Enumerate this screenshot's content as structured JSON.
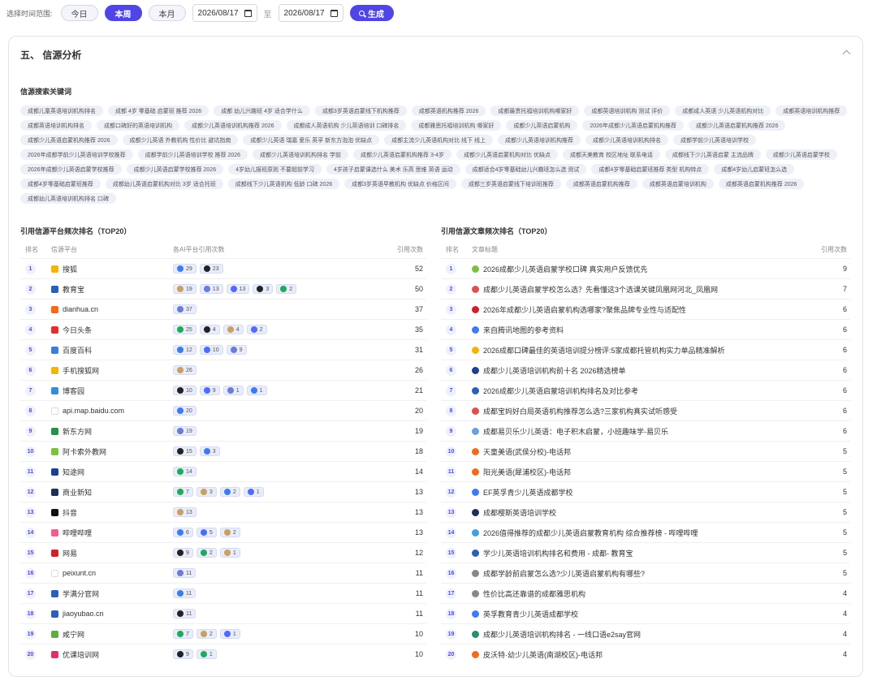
{
  "filters": {
    "label": "选择时间范围:",
    "options": [
      "今日",
      "本周",
      "本月"
    ],
    "active_index": 1,
    "date_start": "2026/08/17",
    "separator": "至",
    "date_end": "2026/08/17",
    "generate_label": "生成"
  },
  "section": {
    "title": "五、 信源分析"
  },
  "keywords": {
    "title": "信源搜索关键词",
    "items": [
      "成都儿童英语培训机构排名",
      "成都 4岁 零基础 启蒙班 推荐 2026",
      "成都 幼儿兴趣班 4岁 适合学什么",
      "成都3岁英语启蒙线下机构推荐",
      "成都英语机构推荐 2026",
      "成都最贵托福培训机构哪家好",
      "成都英语培训机构 测试 评价",
      "成都成人英语 少儿英语机构对比",
      "成都英语培训机构推荐",
      "成都英语培训机构排名",
      "成都口碑好的英语培训机构",
      "成都少儿英语培训机构推荐 2026",
      "成都成人英语机构 少儿英语培训 口碑排名",
      "成都雅思托福培训机构 哪家好",
      "成都少儿英语启蒙机构",
      "2026年成都少儿英语启蒙机构推荐",
      "成都少儿英语启蒙机构推荐 2026",
      "成都少儿英语启蒙机构推荐 2026",
      "成都少儿英语 外教机构 性价比 避坑指南",
      "成都少儿英语 瑞嘉 爱乐 英孚 新东方泡泡 优缺点",
      "成都主流少儿英语机构对比 线下 线上",
      "成都少儿英语培训机构推荐",
      "成都少儿英语培训机构排名",
      "成都学前少儿英语培训学校",
      "2026年成都学前少儿英语培训学校推荐",
      "成都学前少儿英语培训学校 推荐 2026",
      "成都少儿英语培训机构排名 学前",
      "成都少儿英语启蒙机构推荐 3-4岁",
      "成都少儿英语启蒙机构对比 优缺点",
      "成都天美教育 校区地址 联系电话",
      "成都线下少儿英语启蒙 主流品牌",
      "成都少儿英语启蒙学校",
      "2026年成都少儿英语启蒙学校推荐",
      "成都少儿英语启蒙学校推荐 2026",
      "4岁幼儿报班原则 不要超前学习",
      "4岁孩子启蒙课选什么 美术 乐高 思维 英语 运动",
      "成都适合4岁零基础幼儿兴趣班怎么选 测试",
      "成都4岁零基础启蒙班推荐 类型 机构特点",
      "成都4岁幼儿启蒙班怎么选",
      "成都4岁零基础启蒙班推荐",
      "成都幼儿英语启蒙机构对比 3岁 适合托班",
      "成都线下少儿英语机构 低龄 口碑 2026",
      "成都3岁英语早教机构 优缺点 价格区间",
      "成都三岁英语启蒙线下培训班推荐",
      "成都英语启蒙机构推荐",
      "成都英语启蒙培训机构",
      "成都英语启蒙机构推荐 2026",
      "成都幼儿英语培训机构排名 口碑"
    ]
  },
  "platforms": {
    "title": "引用信源平台频次排名（TOP20）",
    "headers": {
      "rank": "排名",
      "name": "信源平台",
      "ai": "各AI平台引用次数",
      "count": "引用次数"
    },
    "rows": [
      {
        "rank": "1",
        "name": "搜狐",
        "icon_color": "#f5b400",
        "count": "52",
        "badges": [
          {
            "icon": "doubao-icon",
            "color": "#3d7bf5",
            "value": "29"
          },
          {
            "icon": "kimi-icon",
            "color": "#222222",
            "value": "23"
          }
        ]
      },
      {
        "rank": "2",
        "name": "教育宝",
        "icon_color": "#2b5fb8",
        "count": "50",
        "badges": [
          {
            "icon": "qwen-icon",
            "color": "#c9a060",
            "value": "19"
          },
          {
            "icon": "wenxin-icon",
            "color": "#6b7bd8",
            "value": "13"
          },
          {
            "icon": "deepseek-icon",
            "color": "#4d6bfe",
            "value": "13"
          },
          {
            "icon": "kimi-icon",
            "color": "#222222",
            "value": "3"
          },
          {
            "icon": "yuanbao-icon",
            "color": "#1eab5b",
            "value": "2"
          }
        ]
      },
      {
        "rank": "3",
        "name": "dianhua.cn",
        "icon_color": "#f26a1b",
        "count": "37",
        "badges": [
          {
            "icon": "wenxin-icon",
            "color": "#6b7bd8",
            "value": "37"
          }
        ]
      },
      {
        "rank": "4",
        "name": "今日头条",
        "icon_color": "#e62c2c",
        "count": "35",
        "badges": [
          {
            "icon": "yuanbao-icon",
            "color": "#1eab5b",
            "value": "25"
          },
          {
            "icon": "kimi-icon",
            "color": "#222222",
            "value": "4"
          },
          {
            "icon": "qwen-icon",
            "color": "#c9a060",
            "value": "4"
          },
          {
            "icon": "deepseek-icon",
            "color": "#4d6bfe",
            "value": "2"
          }
        ]
      },
      {
        "rank": "5",
        "name": "百度百科",
        "icon_color": "#3b7de0",
        "count": "31",
        "badges": [
          {
            "icon": "doubao-icon",
            "color": "#3d7bf5",
            "value": "12"
          },
          {
            "icon": "deepseek-icon",
            "color": "#4d6bfe",
            "value": "10"
          },
          {
            "icon": "wenxin-icon",
            "color": "#6b7bd8",
            "value": "9"
          }
        ]
      },
      {
        "rank": "6",
        "name": "手机搜狐网",
        "icon_color": "#f5b400",
        "count": "26",
        "badges": [
          {
            "icon": "qwen-icon",
            "color": "#c9a060",
            "value": "26"
          }
        ]
      },
      {
        "rank": "7",
        "name": "博客园",
        "icon_color": "#2f8fd8",
        "count": "21",
        "badges": [
          {
            "icon": "kimi-icon",
            "color": "#222222",
            "value": "10"
          },
          {
            "icon": "deepseek-icon",
            "color": "#4d6bfe",
            "value": "9"
          },
          {
            "icon": "wenxin-icon",
            "color": "#6b7bd8",
            "value": "1"
          },
          {
            "icon": "doubao-icon",
            "color": "#3d7bf5",
            "value": "1"
          }
        ]
      },
      {
        "rank": "8",
        "name": "api.map.baidu.com",
        "icon_color": "#ffffff",
        "count": "20",
        "badges": [
          {
            "icon": "doubao-icon",
            "color": "#3d7bf5",
            "value": "20"
          }
        ]
      },
      {
        "rank": "9",
        "name": "新东方网",
        "icon_color": "#2a8f4a",
        "count": "19",
        "badges": [
          {
            "icon": "wenxin-icon",
            "color": "#6b7bd8",
            "value": "19"
          }
        ]
      },
      {
        "rank": "10",
        "name": "阿卡索外教网",
        "icon_color": "#7fbf3f",
        "count": "18",
        "badges": [
          {
            "icon": "kimi-icon",
            "color": "#222222",
            "value": "15"
          },
          {
            "icon": "doubao-icon",
            "color": "#3d7bf5",
            "value": "3"
          }
        ]
      },
      {
        "rank": "11",
        "name": "知途网",
        "icon_color": "#1f3f8f",
        "count": "14",
        "badges": [
          {
            "icon": "yuanbao-icon",
            "color": "#1eab5b",
            "value": "14"
          }
        ]
      },
      {
        "rank": "12",
        "name": "商业新知",
        "icon_color": "#1d2f5a",
        "count": "13",
        "badges": [
          {
            "icon": "yuanbao-icon",
            "color": "#1eab5b",
            "value": "7"
          },
          {
            "icon": "qwen-icon",
            "color": "#c9a060",
            "value": "3"
          },
          {
            "icon": "doubao-icon",
            "color": "#3d7bf5",
            "value": "2"
          },
          {
            "icon": "deepseek-icon",
            "color": "#4d6bfe",
            "value": "1"
          }
        ]
      },
      {
        "rank": "13",
        "name": "抖音",
        "icon_color": "#111111",
        "count": "13",
        "badges": [
          {
            "icon": "qwen-icon",
            "color": "#c9a060",
            "value": "13"
          }
        ]
      },
      {
        "rank": "14",
        "name": "哔哩哔哩",
        "icon_color": "#f25d8e",
        "count": "13",
        "badges": [
          {
            "icon": "doubao-icon",
            "color": "#3d7bf5",
            "value": "6"
          },
          {
            "icon": "deepseek-icon",
            "color": "#4d6bfe",
            "value": "5"
          },
          {
            "icon": "qwen-icon",
            "color": "#c9a060",
            "value": "2"
          }
        ]
      },
      {
        "rank": "15",
        "name": "网易",
        "icon_color": "#d0202a",
        "count": "12",
        "badges": [
          {
            "icon": "kimi-icon",
            "color": "#222222",
            "value": "9"
          },
          {
            "icon": "yuanbao-icon",
            "color": "#1eab5b",
            "value": "2"
          },
          {
            "icon": "qwen-icon",
            "color": "#c9a060",
            "value": "1"
          }
        ]
      },
      {
        "rank": "16",
        "name": "peixunt.cn",
        "icon_color": "#ffffff",
        "count": "11",
        "badges": [
          {
            "icon": "wenxin-icon",
            "color": "#6b7bd8",
            "value": "11"
          }
        ]
      },
      {
        "rank": "17",
        "name": "学满分官网",
        "icon_color": "#2b5fb8",
        "count": "11",
        "badges": [
          {
            "icon": "doubao-icon",
            "color": "#3d7bf5",
            "value": "11"
          }
        ]
      },
      {
        "rank": "18",
        "name": "jiaoyubao.cn",
        "icon_color": "#2b5fb8",
        "count": "11",
        "badges": [
          {
            "icon": "kimi-icon",
            "color": "#222222",
            "value": "11"
          }
        ]
      },
      {
        "rank": "19",
        "name": "咸宁网",
        "icon_color": "#5fae3f",
        "count": "10",
        "badges": [
          {
            "icon": "yuanbao-icon",
            "color": "#1eab5b",
            "value": "7"
          },
          {
            "icon": "qwen-icon",
            "color": "#c9a060",
            "value": "2"
          },
          {
            "icon": "deepseek-icon",
            "color": "#4d6bfe",
            "value": "1"
          }
        ]
      },
      {
        "rank": "20",
        "name": "优课培训网",
        "icon_color": "#e0306a",
        "count": "10",
        "badges": [
          {
            "icon": "kimi-icon",
            "color": "#222222",
            "value": "9"
          },
          {
            "icon": "yuanbao-icon",
            "color": "#1eab5b",
            "value": "1"
          }
        ]
      }
    ]
  },
  "articles": {
    "title": "引用信源文章频次排名（TOP20）",
    "headers": {
      "rank": "排名",
      "title": "文章标题",
      "count": "引用次数"
    },
    "rows": [
      {
        "rank": "1",
        "title": "2026成都少儿英语启蒙学校口碑 真实用户反馈优先",
        "icon_color": "#7fbf3f",
        "count": "9"
      },
      {
        "rank": "2",
        "title": "成都少儿英语启蒙学校怎么选？先看懂这3个选课关键凤凰网河北_凤凰网",
        "icon_color": "#e0504a",
        "count": "7"
      },
      {
        "rank": "3",
        "title": "2026年成都少儿英语启蒙机构选哪家?聚焦品牌专业性与适配性",
        "icon_color": "#d0202a",
        "count": "6"
      },
      {
        "rank": "4",
        "title": "来自腾讯地图的参考资料",
        "icon_color": "#3d7bf5",
        "count": "6"
      },
      {
        "rank": "5",
        "title": "2026成都口碑最佳的英语培训提分榜评:5家成都托管机构实力单品精准解析",
        "icon_color": "#f5b400",
        "count": "6"
      },
      {
        "rank": "6",
        "title": "成都少儿英语培训机构前十名 2026精选榜单",
        "icon_color": "#1f3f8f",
        "count": "6"
      },
      {
        "rank": "7",
        "title": "2026成都少儿英语启蒙培训机构排名及对比参考",
        "icon_color": "#2b5fb8",
        "count": "6"
      },
      {
        "rank": "8",
        "title": "成都宝妈好白局英语机构推荐怎么选?三家机构真实试听感受",
        "icon_color": "#e0504a",
        "count": "6"
      },
      {
        "rank": "9",
        "title": "成都易贝乐少儿英语：电子积木启蒙，小班趣味学-易贝乐",
        "icon_color": "#6aa0e0",
        "count": "6"
      },
      {
        "rank": "10",
        "title": "天童美语(武侯分校)-电话邦",
        "icon_color": "#f26a1b",
        "count": "5"
      },
      {
        "rank": "11",
        "title": "阳光美语(犀浦校区)-电话邦",
        "icon_color": "#f26a1b",
        "count": "5"
      },
      {
        "rank": "12",
        "title": "EF英孚青少儿英语成都学校",
        "icon_color": "#3d7bf5",
        "count": "5"
      },
      {
        "rank": "13",
        "title": "成都樱斯英语培训学校",
        "icon_color": "#1d2f5a",
        "count": "5"
      },
      {
        "rank": "14",
        "title": "2026值得推荐的成都少儿英语启蒙教育机构 综合推荐榜 - 哔哩哔哩",
        "icon_color": "#3fa0e0",
        "count": "5"
      },
      {
        "rank": "15",
        "title": "学少儿英语培训机构排名和费用 - 成都- 教育宝",
        "icon_color": "#2b5fb8",
        "count": "5"
      },
      {
        "rank": "16",
        "title": "成都学龄前启蒙怎么选?少儿英语启蒙机构有哪些?",
        "icon_color": "#888888",
        "count": "5"
      },
      {
        "rank": "17",
        "title": "性价比高还靠谱的成都雅思机构",
        "icon_color": "#888888",
        "count": "4"
      },
      {
        "rank": "18",
        "title": "英孚教育青少儿英语成都学校",
        "icon_color": "#3d7bf5",
        "count": "4"
      },
      {
        "rank": "19",
        "title": "成都少儿英语培训机构排名 - 一线口语e2say官网",
        "icon_color": "#2a8f6a",
        "count": "4"
      },
      {
        "rank": "20",
        "title": "皮沃特·幼少儿英语(南湖校区)-电话邦",
        "icon_color": "#f26a1b",
        "count": "4"
      }
    ]
  }
}
